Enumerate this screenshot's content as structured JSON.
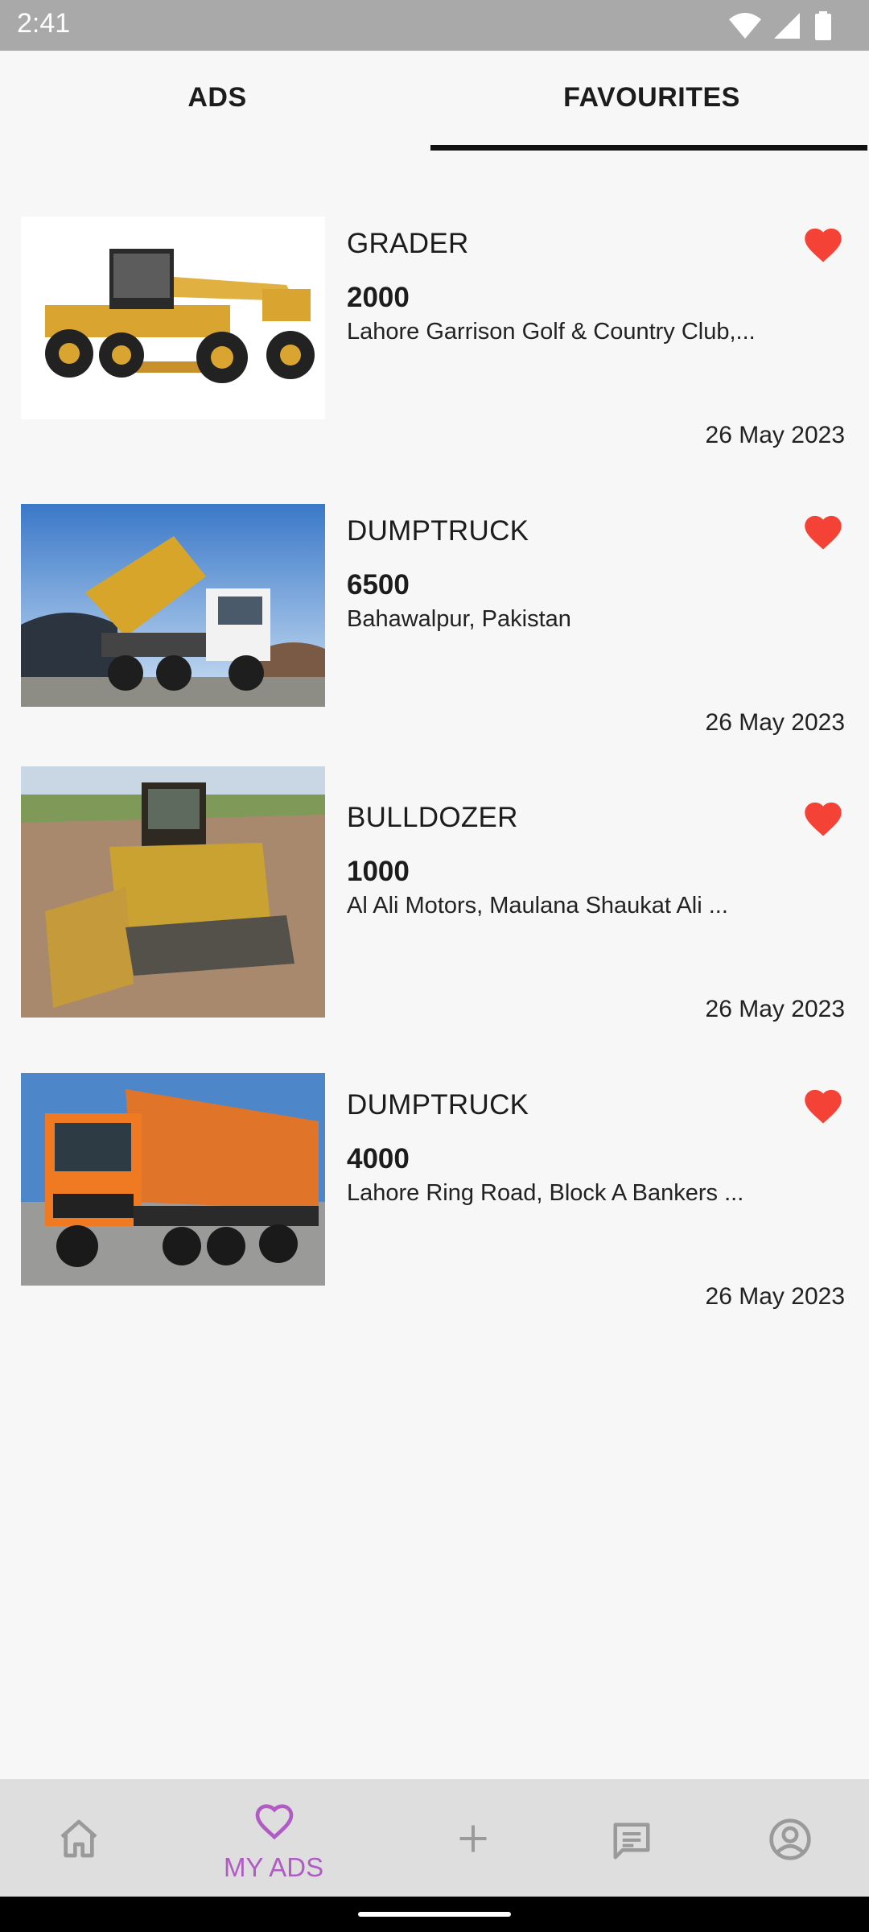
{
  "status_bar": {
    "time": "2:41"
  },
  "tabs": [
    {
      "label": "ADS",
      "selected": false
    },
    {
      "label": "FAVOURITES",
      "selected": true
    }
  ],
  "favourites": [
    {
      "title": "GRADER",
      "price": "2000",
      "location": "Lahore Garrison Golf & Country Club,...",
      "date": "26 May 2023",
      "favourite": true,
      "image": "grader"
    },
    {
      "title": "DUMPTRUCK",
      "price": "6500",
      "location": "Bahawalpur, Pakistan",
      "date": "26 May 2023",
      "favourite": true,
      "image": "dump-truck-white"
    },
    {
      "title": "BULLDOZER",
      "price": "1000",
      "location": "Al Ali Motors, Maulana Shaukat Ali ...",
      "date": "26 May 2023",
      "favourite": true,
      "image": "bulldozer"
    },
    {
      "title": "DUMPTRUCK",
      "price": "4000",
      "location": "Lahore Ring Road, Block A Bankers ...",
      "date": "26 May 2023",
      "favourite": true,
      "image": "dump-truck-orange"
    }
  ],
  "bottom_nav": {
    "items": [
      {
        "icon": "home-icon",
        "label": ""
      },
      {
        "icon": "heart-outline-icon",
        "label": "MY ADS",
        "selected": true
      },
      {
        "icon": "plus-icon",
        "label": ""
      },
      {
        "icon": "chat-icon",
        "label": ""
      },
      {
        "icon": "account-icon",
        "label": ""
      }
    ]
  },
  "colors": {
    "heart": "#f44336",
    "accent": "#b05cc4",
    "tab_indicator": "#111111",
    "nav_background": "#dedede",
    "status_bar": "#a9a9a9"
  }
}
